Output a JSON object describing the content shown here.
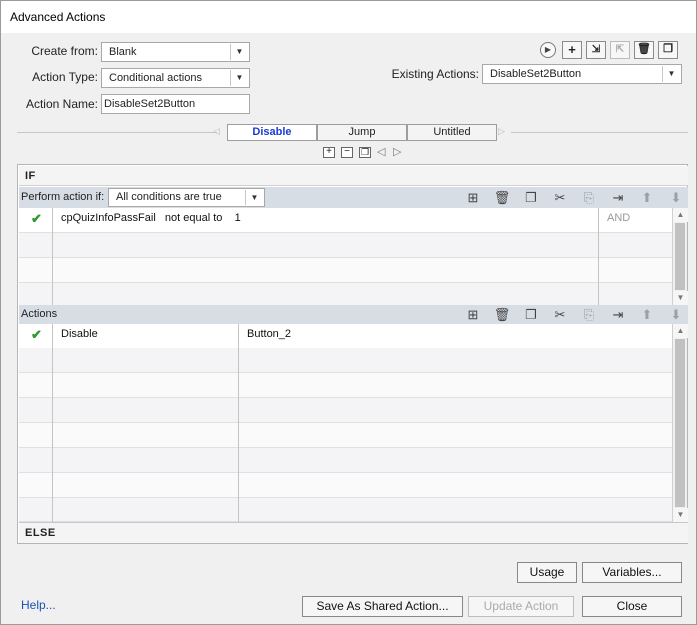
{
  "window": {
    "title": "Advanced Actions"
  },
  "form": {
    "create_from_label": "Create from:",
    "create_from_value": "Blank",
    "action_type_label": "Action Type:",
    "action_type_value": "Conditional actions",
    "action_name_label": "Action Name:",
    "action_name_value": "DisableSet2Button",
    "existing_actions_label": "Existing Actions:",
    "existing_actions_value": "DisableSet2Button"
  },
  "toolbar": {
    "icons": [
      "preview-icon",
      "add-icon",
      "import-icon",
      "export-icon",
      "delete-icon",
      "duplicate-icon"
    ]
  },
  "decision_tabs": [
    "Disable",
    "Jump",
    "Untitled"
  ],
  "if_section": {
    "header": "IF",
    "perform_label": "Perform action if:",
    "perform_value": "All conditions are true",
    "conditions": [
      {
        "checked": true,
        "text": "cpQuizInfoPassFail   not equal to    1",
        "operator": "AND"
      },
      {
        "checked": false,
        "text": "",
        "operator": ""
      },
      {
        "checked": false,
        "text": "",
        "operator": ""
      },
      {
        "checked": false,
        "text": "",
        "operator": ""
      }
    ]
  },
  "actions_section": {
    "header": "Actions",
    "rows": [
      {
        "checked": true,
        "action": "Disable",
        "target": "Button_2"
      },
      {
        "checked": false,
        "action": "",
        "target": ""
      },
      {
        "checked": false,
        "action": "",
        "target": ""
      },
      {
        "checked": false,
        "action": "",
        "target": ""
      },
      {
        "checked": false,
        "action": "",
        "target": ""
      },
      {
        "checked": false,
        "action": "",
        "target": ""
      },
      {
        "checked": false,
        "action": "",
        "target": ""
      },
      {
        "checked": false,
        "action": "",
        "target": ""
      }
    ]
  },
  "else_section": {
    "header": "ELSE"
  },
  "buttons": {
    "usage": "Usage",
    "variables": "Variables...",
    "help": "Help...",
    "save_shared": "Save As Shared Action...",
    "update": "Update Action",
    "close": "Close"
  }
}
